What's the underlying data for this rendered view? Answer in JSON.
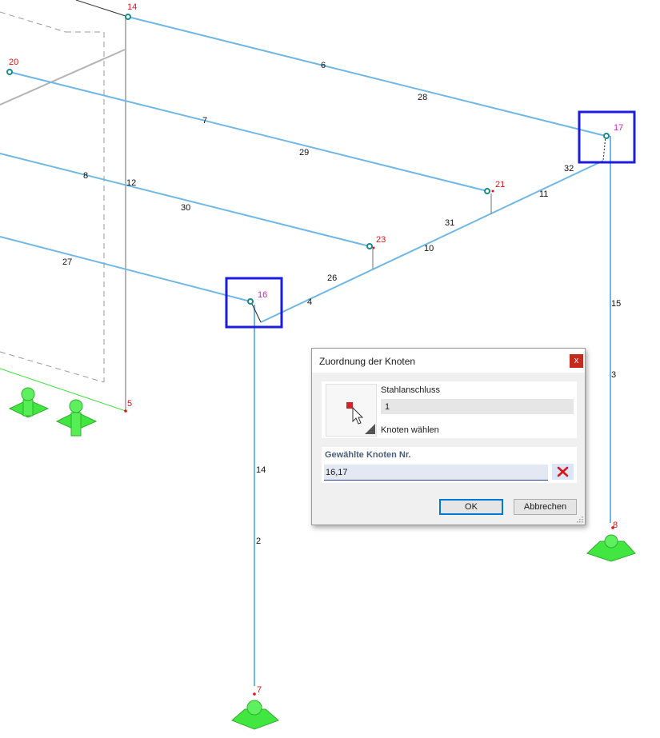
{
  "model": {
    "node_labels": [
      "14",
      "20",
      "17",
      "21",
      "23",
      "16",
      "5",
      "8",
      "7"
    ],
    "member_labels": [
      "6",
      "28",
      "7",
      "29",
      "8",
      "12",
      "30",
      "32",
      "11",
      "31",
      "10",
      "27",
      "26",
      "4",
      "15",
      "3",
      "14",
      "2"
    ],
    "colors": {
      "member": "#6fb8e6",
      "node_number": "#e0141a",
      "selected_node_number": "#d020c8",
      "selection_box": "#1c1ce0",
      "support": "#3fe23f"
    }
  },
  "dialog": {
    "title": "Zuordnung der Knoten",
    "close_label": "x",
    "steel_connection_label": "Stahlanschluss",
    "steel_connection_value": "1",
    "pick_label": "Knoten wählen",
    "selected_nodes_title": "Gewählte Knoten Nr.",
    "selected_nodes_value": "16,17",
    "clear_icon": "red-x-icon",
    "ok_label": "OK",
    "cancel_label": "Abbrechen"
  }
}
